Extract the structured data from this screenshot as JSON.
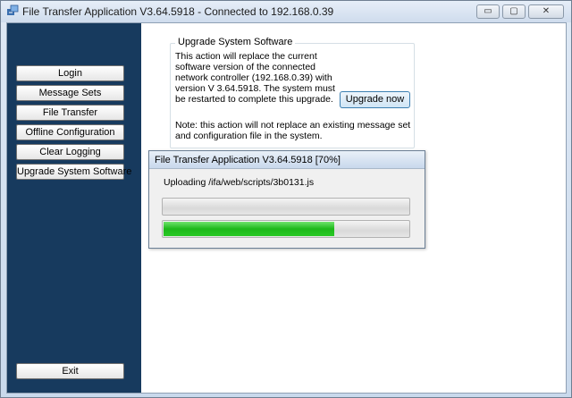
{
  "window": {
    "title": "File Transfer Application V3.64.5918 - Connected to 192.168.0.39",
    "controls": {
      "minimize": "▭",
      "maximize": "▢",
      "close": "✕"
    }
  },
  "sidebar": {
    "items": [
      {
        "label": "Login"
      },
      {
        "label": "Message Sets"
      },
      {
        "label": "File Transfer"
      },
      {
        "label": "Offline Configuration"
      },
      {
        "label": "Clear Logging"
      },
      {
        "label": "Upgrade System Software"
      }
    ],
    "exit_label": "Exit"
  },
  "main": {
    "group_title": "Upgrade System Software",
    "description": "This action will replace the current software version of the connected network controller (192.168.0.39) with version V 3.64.5918. The system must be restarted to complete this upgrade.",
    "upgrade_button": "Upgrade now",
    "note": "Note: this action will not replace an existing message set and configuration file in the system."
  },
  "progress_dialog": {
    "title": "File Transfer Application V3.64.5918 [70%]",
    "status_text": "Uploading /ifa/web/scripts/3b0131.js",
    "overall_progress": 0,
    "file_progress": 0.7,
    "fill_color": "#22c21f"
  }
}
